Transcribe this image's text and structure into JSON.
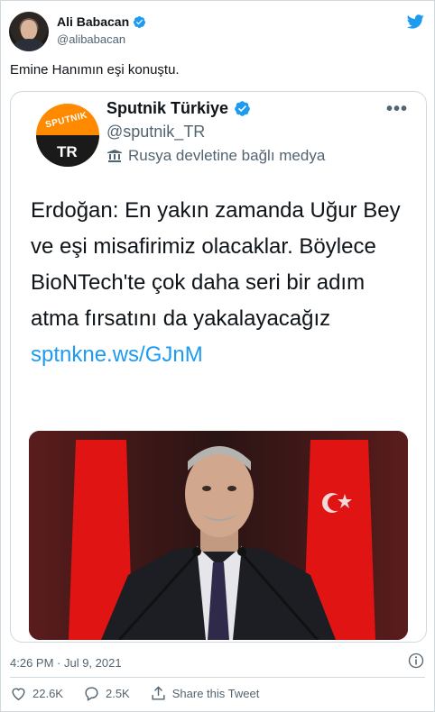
{
  "author": {
    "name": "Ali Babacan",
    "handle": "@alibabacan"
  },
  "tweet": {
    "text": "Emine Hanımın eşi konuştu.",
    "timestamp": "4:26 PM · Jul 9, 2021"
  },
  "quoted": {
    "logo_text": "SPUTNIK",
    "logo_sub": "TR",
    "name": "Sputnik Türkiye",
    "handle": "@sputnik_TR",
    "affiliation": "Rusya devletine bağlı medya",
    "more": "•••",
    "body": "Erdoğan: En yakın zamanda Uğur Bey ve eşi misafirimiz olacaklar. Böylece BioNTech'te çok daha seri bir adım atma fırsatını da yakalayacağız",
    "link": "sptnkne.ws/GJnM"
  },
  "actions": {
    "likes": "22.6K",
    "replies": "2.5K",
    "share_label": "Share this Tweet"
  },
  "colors": {
    "accent": "#1d9bf0",
    "secondary_text": "#536471",
    "border": "#cfd9de",
    "sputnik_orange": "#ff8a00"
  },
  "icons": [
    "verified-icon",
    "twitter-bird-icon",
    "more-icon",
    "state-media-icon",
    "photo",
    "info-icon",
    "heart-icon",
    "reply-icon",
    "share-icon"
  ]
}
